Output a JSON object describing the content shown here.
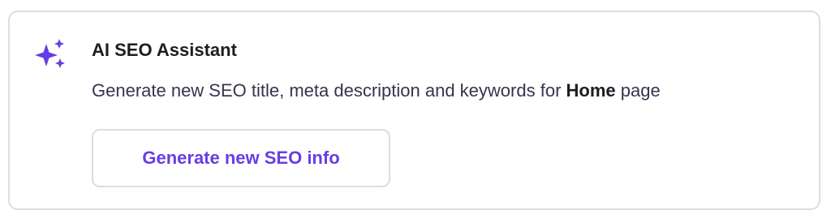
{
  "colors": {
    "accent": "#673de6",
    "title": "#1d1e20",
    "text": "#36344d",
    "border": "#dadce6"
  },
  "card": {
    "icon": "sparkles-icon",
    "title": "AI SEO Assistant",
    "description_prefix": "Generate new SEO title, meta description and keywords for ",
    "description_page": "Home",
    "description_suffix": " page",
    "button_label": "Generate new SEO info"
  }
}
